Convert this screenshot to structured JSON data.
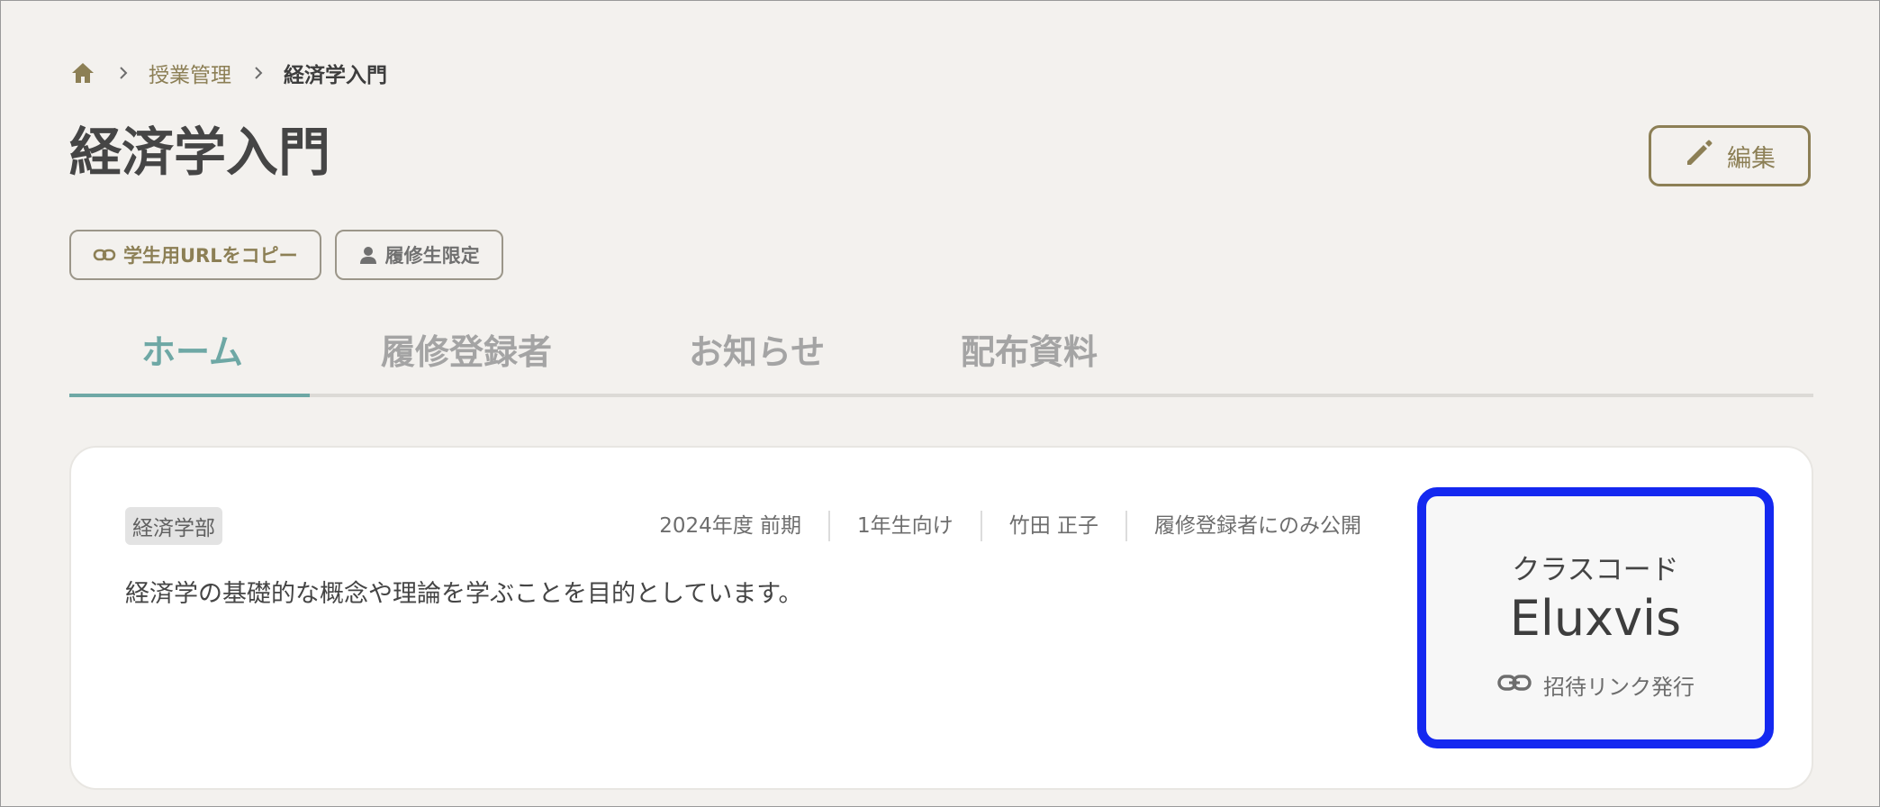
{
  "breadcrumb": {
    "home_icon": "home-icon",
    "separator_icon": "chevron-right-icon",
    "parent": "授業管理",
    "current": "経済学入門"
  },
  "page": {
    "title": "経済学入門"
  },
  "edit_button": {
    "icon": "pencil-icon",
    "label": "編集"
  },
  "chips": {
    "copy_url": {
      "icon": "link-icon",
      "label": "学生用URLをコピー"
    },
    "enrolled_only": {
      "icon": "person-icon",
      "label": "履修生限定"
    }
  },
  "tabs": [
    {
      "label": "ホーム",
      "active": true
    },
    {
      "label": "履修登録者",
      "active": false
    },
    {
      "label": "お知らせ",
      "active": false
    },
    {
      "label": "配布資料",
      "active": false
    }
  ],
  "course": {
    "department": "経済学部",
    "meta": {
      "term": "2024年度 前期",
      "audience": "1年生向け",
      "instructor": "竹田 正子",
      "visibility": "履修登録者にのみ公開"
    },
    "description": "経済学の基礎的な概念や理論を学ぶことを目的としています。"
  },
  "class_code": {
    "label": "クラスコード",
    "value": "Eluxvis",
    "invite_icon": "link-icon",
    "invite_label": "招待リンク発行"
  },
  "colors": {
    "accent_gold": "#8c7f55",
    "tab_active": "#6ea8a5",
    "highlight_border": "#1428f0",
    "background": "#f3f1ee"
  }
}
